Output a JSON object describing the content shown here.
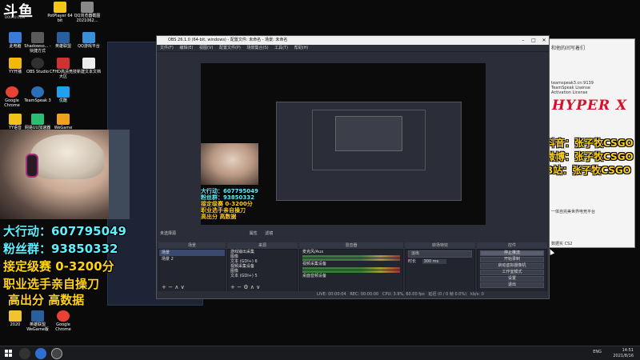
{
  "brand": {
    "logo": "斗鱼",
    "sub": "DOUYU.COM"
  },
  "desktop_icons": [
    {
      "label": "此电脑",
      "color": "#3a7bd5"
    },
    {
      "label": "Shadowso... - 快捷方式",
      "color": "#5a5a5a"
    },
    {
      "label": "英雄联盟",
      "color": "#2a5f9e"
    },
    {
      "label": "QQ游戏平台",
      "color": "#3b8fd9"
    },
    {
      "label": "YY开播",
      "color": "#f0b90b"
    },
    {
      "label": "OBS Studio",
      "color": "#303030"
    },
    {
      "label": "CFHD高清竞技大区",
      "color": "#c33"
    },
    {
      "label": "新建文本文档",
      "color": "#eee"
    },
    {
      "label": "Google Chrome",
      "color": "#e94235"
    },
    {
      "label": "TeamSpeak 3",
      "color": "#2b6fb8"
    },
    {
      "label": "优酷",
      "color": "#1ea2f0"
    },
    {
      "label": "YY语音",
      "color": "#f3c21a"
    },
    {
      "label": "网易UU加速器",
      "color": "#2bbd73"
    },
    {
      "label": "WeGame",
      "color": "#f1a21c"
    },
    {
      "label": "PotPlayer 64 bit",
      "color": "#f5c518"
    },
    {
      "label": "QQ浏览器截图2021062...",
      "color": "#888"
    },
    {
      "label": "2020",
      "color": "#f0c330"
    },
    {
      "label": "英雄联盟WeGame版",
      "color": "#2a5f9e"
    },
    {
      "label": "Google Chrome",
      "color": "#e94235"
    }
  ],
  "overlay": {
    "line1": "大行动：607795049",
    "line2": "粉丝群：93850332",
    "line3": "接定级赛 0-3200分",
    "line4": "职业选手亲自操刀",
    "line5": "高出分 高数据"
  },
  "right_panel": {
    "header": "和他的间写着们",
    "rows": [
      "teamspeak3.cn:9139",
      "TeamSpeak Lisense",
      "Activation License"
    ],
    "brand": "HYPER X",
    "lines": [
      {
        "label": "抖音：",
        "value": "张子牧CSGO"
      },
      {
        "label": "微博：",
        "value": "张子牧CSGO"
      },
      {
        "label": "B站：",
        "value": "张子牧CSGO"
      }
    ],
    "footer": "一体自完美世界电竞平台",
    "bottom": "数据实 CS2"
  },
  "obs": {
    "title": "OBS 26.1.0 (64-bit, windows) - 配置文件: 未命名 - 场景: 未命名",
    "menu": [
      "文件(F)",
      "编辑(E)",
      "视图(V)",
      "配置文件(P)",
      "场景集合(S)",
      "工具(T)",
      "帮助(H)"
    ],
    "scene_label": "未选择源",
    "props_btn": "属性",
    "filters_btn": "滤镜",
    "docks": {
      "scenes": {
        "title": "场景",
        "items": [
          "场景",
          "场景 2"
        ]
      },
      "sources": {
        "title": "来源",
        "items": [
          "游戏输出采集",
          "图像",
          "文本 (GDI+) 6",
          "视频采集设备",
          "图像",
          "文本 (GDI+) 5",
          "图像"
        ]
      },
      "mixer": {
        "title": "混音器",
        "channels": [
          "麦克风/Aux",
          "视频采集设备",
          "桌面音频设备"
        ]
      },
      "transitions": {
        "title": "转场特效",
        "type": "淡出",
        "duration_label": "时长",
        "duration": "300 ms"
      },
      "controls": {
        "title": "控件",
        "buttons": [
          "停止推流",
          "开始录制",
          "启动虚拟摄像机",
          "工作室模式",
          "设置",
          "退出"
        ]
      }
    },
    "status": {
      "live": "LIVE: 00:00:04",
      "rec": "REC: 00:00:00",
      "cpu": "CPU: 3.9%, 60.00 fps",
      "dropped": "延迟 (0 / 0 帧 0.0%)",
      "kbps": "kb/s: 0"
    }
  },
  "taskbar": {
    "lang": "ENG",
    "time": "14:51",
    "date": "2021/8/16"
  }
}
